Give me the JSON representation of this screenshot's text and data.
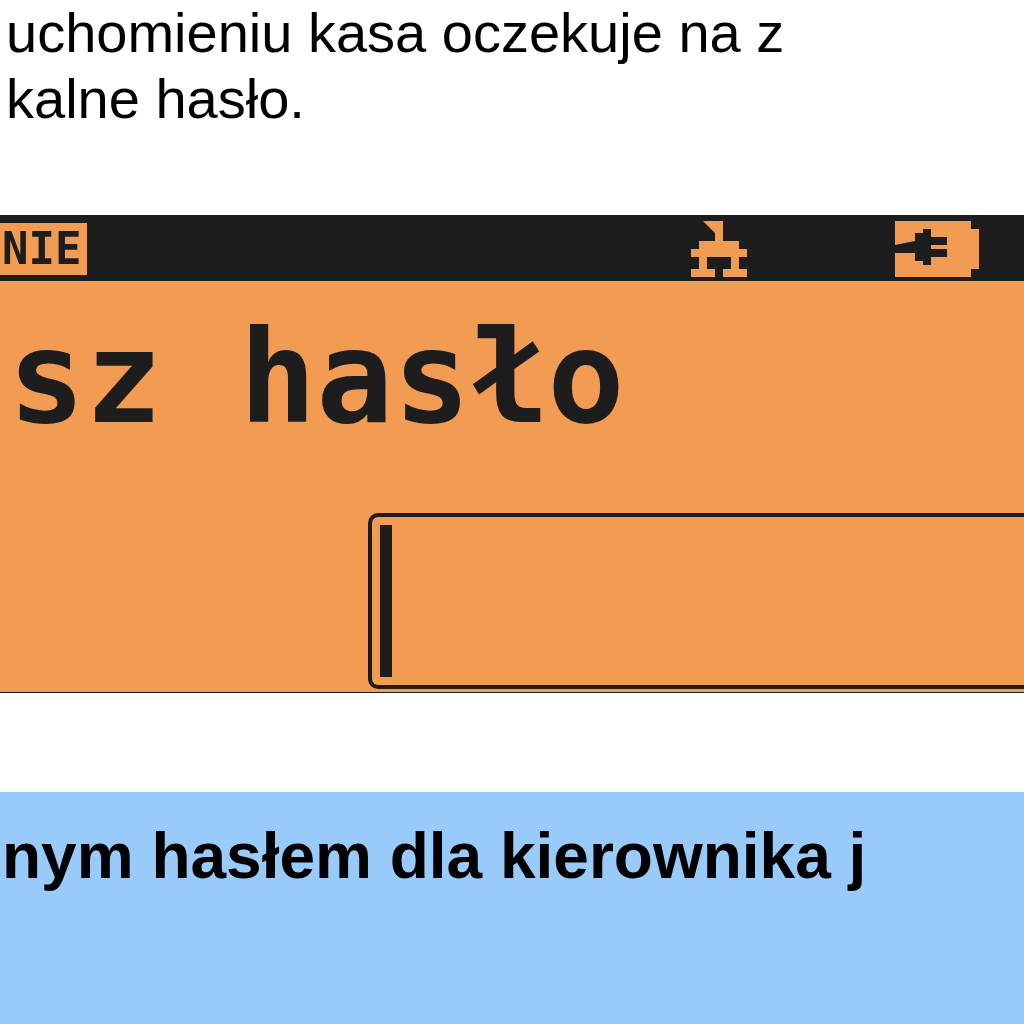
{
  "document": {
    "paragraph_lines": [
      "uchomieniu kasa oczekuje na z",
      "kalne hasło."
    ]
  },
  "display": {
    "status_badge": "NIE",
    "title": "sz hasło"
  },
  "note": {
    "text": "nym hasłem dla kierownika j"
  }
}
